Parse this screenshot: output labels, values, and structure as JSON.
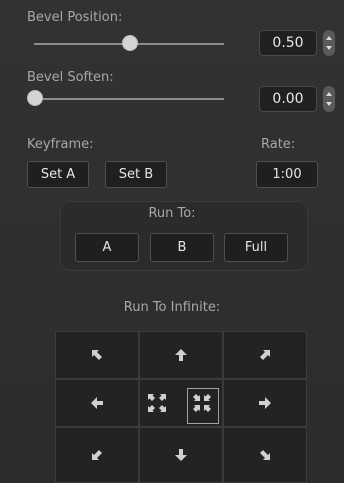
{
  "bevel_position": {
    "label": "Bevel Position:",
    "value": "0.50",
    "slider_fraction": 0.5
  },
  "bevel_soften": {
    "label": "Bevel Soften:",
    "value": "0.00",
    "slider_fraction": 0.0
  },
  "keyframe": {
    "label": "Keyframe:",
    "set_a": "Set A",
    "set_b": "Set B"
  },
  "rate": {
    "label": "Rate:",
    "value": "1:00"
  },
  "run_to": {
    "label": "Run To:",
    "a": "A",
    "b": "B",
    "full": "Full"
  },
  "run_to_infinite": {
    "label": "Run To Infinite:"
  },
  "colors": {
    "background": "#2f2f2f",
    "button_bg": "#1f1f1f",
    "text": "#e7e7e7",
    "label": "#a8a8a8"
  }
}
